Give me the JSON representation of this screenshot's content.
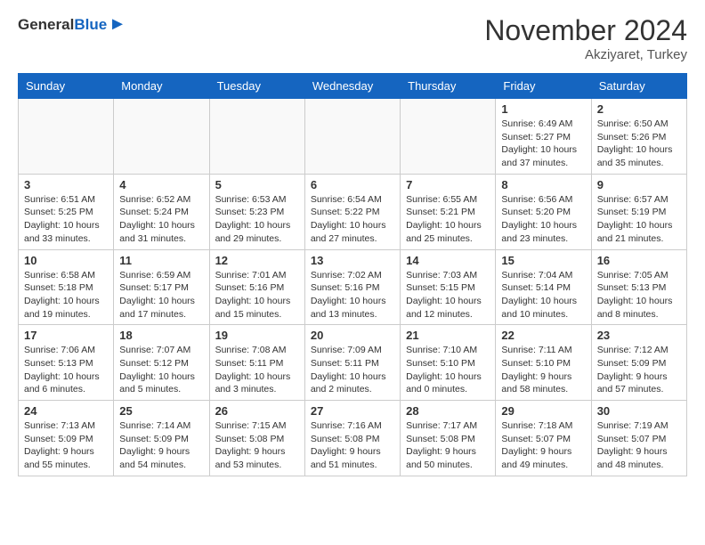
{
  "header": {
    "logo_general": "General",
    "logo_blue": "Blue",
    "month": "November 2024",
    "location": "Akziyaret, Turkey"
  },
  "weekdays": [
    "Sunday",
    "Monday",
    "Tuesday",
    "Wednesday",
    "Thursday",
    "Friday",
    "Saturday"
  ],
  "weeks": [
    [
      {
        "day": "",
        "info": ""
      },
      {
        "day": "",
        "info": ""
      },
      {
        "day": "",
        "info": ""
      },
      {
        "day": "",
        "info": ""
      },
      {
        "day": "",
        "info": ""
      },
      {
        "day": "1",
        "info": "Sunrise: 6:49 AM\nSunset: 5:27 PM\nDaylight: 10 hours\nand 37 minutes."
      },
      {
        "day": "2",
        "info": "Sunrise: 6:50 AM\nSunset: 5:26 PM\nDaylight: 10 hours\nand 35 minutes."
      }
    ],
    [
      {
        "day": "3",
        "info": "Sunrise: 6:51 AM\nSunset: 5:25 PM\nDaylight: 10 hours\nand 33 minutes."
      },
      {
        "day": "4",
        "info": "Sunrise: 6:52 AM\nSunset: 5:24 PM\nDaylight: 10 hours\nand 31 minutes."
      },
      {
        "day": "5",
        "info": "Sunrise: 6:53 AM\nSunset: 5:23 PM\nDaylight: 10 hours\nand 29 minutes."
      },
      {
        "day": "6",
        "info": "Sunrise: 6:54 AM\nSunset: 5:22 PM\nDaylight: 10 hours\nand 27 minutes."
      },
      {
        "day": "7",
        "info": "Sunrise: 6:55 AM\nSunset: 5:21 PM\nDaylight: 10 hours\nand 25 minutes."
      },
      {
        "day": "8",
        "info": "Sunrise: 6:56 AM\nSunset: 5:20 PM\nDaylight: 10 hours\nand 23 minutes."
      },
      {
        "day": "9",
        "info": "Sunrise: 6:57 AM\nSunset: 5:19 PM\nDaylight: 10 hours\nand 21 minutes."
      }
    ],
    [
      {
        "day": "10",
        "info": "Sunrise: 6:58 AM\nSunset: 5:18 PM\nDaylight: 10 hours\nand 19 minutes."
      },
      {
        "day": "11",
        "info": "Sunrise: 6:59 AM\nSunset: 5:17 PM\nDaylight: 10 hours\nand 17 minutes."
      },
      {
        "day": "12",
        "info": "Sunrise: 7:01 AM\nSunset: 5:16 PM\nDaylight: 10 hours\nand 15 minutes."
      },
      {
        "day": "13",
        "info": "Sunrise: 7:02 AM\nSunset: 5:16 PM\nDaylight: 10 hours\nand 13 minutes."
      },
      {
        "day": "14",
        "info": "Sunrise: 7:03 AM\nSunset: 5:15 PM\nDaylight: 10 hours\nand 12 minutes."
      },
      {
        "day": "15",
        "info": "Sunrise: 7:04 AM\nSunset: 5:14 PM\nDaylight: 10 hours\nand 10 minutes."
      },
      {
        "day": "16",
        "info": "Sunrise: 7:05 AM\nSunset: 5:13 PM\nDaylight: 10 hours\nand 8 minutes."
      }
    ],
    [
      {
        "day": "17",
        "info": "Sunrise: 7:06 AM\nSunset: 5:13 PM\nDaylight: 10 hours\nand 6 minutes."
      },
      {
        "day": "18",
        "info": "Sunrise: 7:07 AM\nSunset: 5:12 PM\nDaylight: 10 hours\nand 5 minutes."
      },
      {
        "day": "19",
        "info": "Sunrise: 7:08 AM\nSunset: 5:11 PM\nDaylight: 10 hours\nand 3 minutes."
      },
      {
        "day": "20",
        "info": "Sunrise: 7:09 AM\nSunset: 5:11 PM\nDaylight: 10 hours\nand 2 minutes."
      },
      {
        "day": "21",
        "info": "Sunrise: 7:10 AM\nSunset: 5:10 PM\nDaylight: 10 hours\nand 0 minutes."
      },
      {
        "day": "22",
        "info": "Sunrise: 7:11 AM\nSunset: 5:10 PM\nDaylight: 9 hours\nand 58 minutes."
      },
      {
        "day": "23",
        "info": "Sunrise: 7:12 AM\nSunset: 5:09 PM\nDaylight: 9 hours\nand 57 minutes."
      }
    ],
    [
      {
        "day": "24",
        "info": "Sunrise: 7:13 AM\nSunset: 5:09 PM\nDaylight: 9 hours\nand 55 minutes."
      },
      {
        "day": "25",
        "info": "Sunrise: 7:14 AM\nSunset: 5:09 PM\nDaylight: 9 hours\nand 54 minutes."
      },
      {
        "day": "26",
        "info": "Sunrise: 7:15 AM\nSunset: 5:08 PM\nDaylight: 9 hours\nand 53 minutes."
      },
      {
        "day": "27",
        "info": "Sunrise: 7:16 AM\nSunset: 5:08 PM\nDaylight: 9 hours\nand 51 minutes."
      },
      {
        "day": "28",
        "info": "Sunrise: 7:17 AM\nSunset: 5:08 PM\nDaylight: 9 hours\nand 50 minutes."
      },
      {
        "day": "29",
        "info": "Sunrise: 7:18 AM\nSunset: 5:07 PM\nDaylight: 9 hours\nand 49 minutes."
      },
      {
        "day": "30",
        "info": "Sunrise: 7:19 AM\nSunset: 5:07 PM\nDaylight: 9 hours\nand 48 minutes."
      }
    ]
  ]
}
